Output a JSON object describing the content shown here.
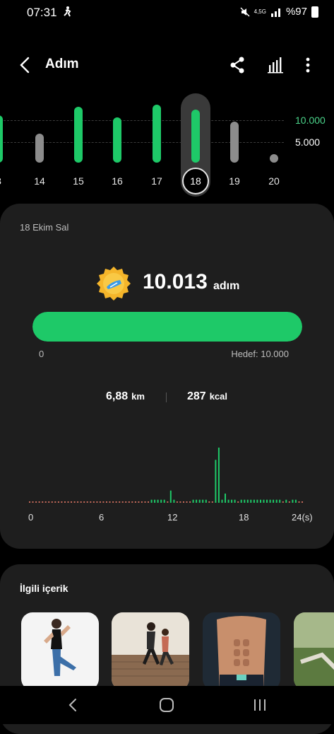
{
  "status_bar": {
    "time": "07:31",
    "network": "4,5G",
    "battery": "%97"
  },
  "app_bar": {
    "title": "Adım"
  },
  "week_chart": {
    "grid_labels": [
      "10.000",
      "5.000"
    ],
    "days": [
      {
        "label": "3",
        "steps": 9000,
        "met": true
      },
      {
        "label": "14",
        "steps": 5500,
        "met": false
      },
      {
        "label": "15",
        "steps": 10500,
        "met": true
      },
      {
        "label": "16",
        "steps": 8500,
        "met": true
      },
      {
        "label": "17",
        "steps": 11000,
        "met": true
      },
      {
        "label": "18",
        "steps": 10013,
        "met": true
      },
      {
        "label": "19",
        "steps": 7800,
        "met": false
      },
      {
        "label": "20",
        "steps": 0,
        "met": false
      }
    ],
    "selected_index": 5
  },
  "summary": {
    "date": "18 Ekim Sal",
    "steps_value": "10.013",
    "steps_unit": "adım",
    "progress_fraction": 1.0,
    "progress_start": "0",
    "goal": "Hedef: 10.000",
    "distance_value": "6,88",
    "distance_unit": "km",
    "calories_value": "287",
    "calories_unit": "kcal"
  },
  "hourly_chart": {
    "x_labels": [
      "0",
      "6",
      "12",
      "18",
      "24(s)"
    ],
    "values": [
      0,
      0,
      0,
      0,
      0,
      0,
      0,
      0,
      0,
      0,
      0,
      0,
      0,
      0,
      0,
      0,
      0,
      0,
      0,
      0,
      0,
      0,
      0,
      0,
      0,
      0,
      0,
      0,
      0,
      0,
      0,
      0,
      0,
      0,
      0,
      0,
      0,
      0,
      1,
      1,
      1,
      1,
      1,
      0,
      4,
      1,
      0,
      0,
      0,
      0,
      0,
      1,
      1,
      1,
      1,
      1,
      0,
      0,
      14,
      18,
      1,
      3,
      1,
      1,
      1,
      0,
      1,
      1,
      1,
      1,
      1,
      1,
      1,
      1,
      1,
      1,
      1,
      1,
      1,
      0,
      1,
      0,
      1,
      1,
      0,
      0
    ]
  },
  "related": {
    "title": "İlgili içerik"
  },
  "colors": {
    "accent": "#1ec968",
    "card": "#1e1e1e",
    "inactive_bar": "#8c8c8c"
  }
}
